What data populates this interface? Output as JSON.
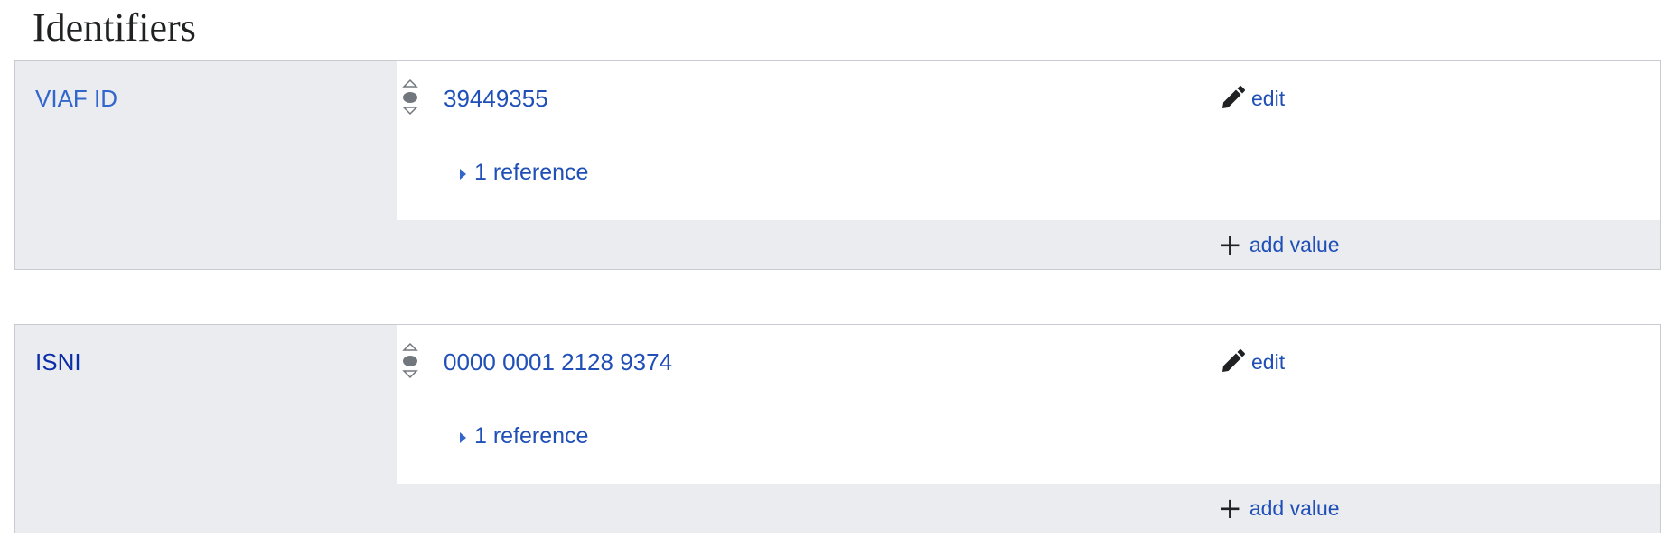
{
  "section": {
    "heading": "Identifiers"
  },
  "statements": [
    {
      "property": "VIAF ID",
      "value": "39449355",
      "edit_label": "edit",
      "references_label": "1 reference",
      "add_value_label": "add value"
    },
    {
      "property": "ISNI",
      "value": "0000 0001 2128 9374",
      "edit_label": "edit",
      "references_label": "1 reference",
      "add_value_label": "add value"
    }
  ],
  "icons": {
    "rank": "rank-selector-icon",
    "edit": "pencil-icon",
    "add": "plus-icon",
    "expand": "expand-triangle-icon"
  },
  "colors": {
    "link": "#1f4fb7",
    "panel": "#eaecf0",
    "border": "#c8ccd1"
  }
}
